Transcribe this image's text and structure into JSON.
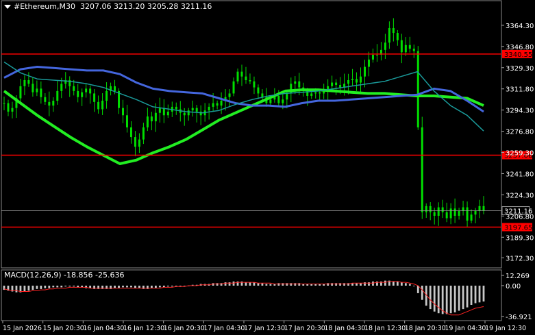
{
  "header": {
    "symbol": "#Ethereum,M30",
    "ohlc": "3207.06 3213.20 3205.28 3211.16"
  },
  "indicator": {
    "label": "MACD(12,26,9) -18.856 -25.636"
  },
  "colors": {
    "background": "#000000",
    "candles": "#00dd00",
    "ma_fast": "#22ee22",
    "ma_mid": "#4466dd",
    "ma_slow": "#1a9a9a",
    "levels": "#ff0000",
    "macd_hist": "#c8c8c8",
    "macd_signal": "#ff2222"
  },
  "chart_data": [
    {
      "type": "line",
      "title": "#Ethereum,M30",
      "ylim": [
        3164,
        3375
      ],
      "y_ticks": [
        "3364.30",
        "3346.80",
        "3329.30",
        "3311.80",
        "3294.30",
        "3276.80",
        "3259.30",
        "3241.80",
        "3224.30",
        "3206.80",
        "3189.30",
        "3172.30"
      ],
      "x_ticks": [
        "15 Jan 2026",
        "15 Jan 20:30",
        "16 Jan 04:30",
        "16 Jan 12:30",
        "16 Jan 20:30",
        "17 Jan 04:30",
        "17 Jan 12:30",
        "17 Jan 20:30",
        "18 Jan 04:30",
        "18 Jan 12:30",
        "18 Jan 20:30",
        "19 Jan 04:30",
        "19 Jan 12:30"
      ],
      "price_line": {
        "value": 3211.16,
        "label": "3211.16"
      },
      "levels": [
        {
          "value": 3340.55,
          "label": "3340.55"
        },
        {
          "value": 3257.06,
          "label": "3257.06"
        },
        {
          "value": 3197.65,
          "label": "3197.65"
        }
      ],
      "close": [
        3300,
        3293,
        3296,
        3304,
        3314,
        3319,
        3316,
        3309,
        3312,
        3305,
        3301,
        3298,
        3302,
        3310,
        3316,
        3319,
        3314,
        3310,
        3305,
        3309,
        3312,
        3308,
        3301,
        3295,
        3302,
        3310,
        3314,
        3310,
        3296,
        3290,
        3280,
        3272,
        3264,
        3270,
        3280,
        3289,
        3285,
        3292,
        3296,
        3290,
        3293,
        3297,
        3295,
        3292,
        3290,
        3294,
        3296,
        3293,
        3290,
        3294,
        3297,
        3300,
        3298,
        3302,
        3305,
        3308,
        3318,
        3326,
        3322,
        3319,
        3318,
        3313,
        3308,
        3305,
        3300,
        3303,
        3306,
        3300,
        3303,
        3308,
        3316,
        3318,
        3313,
        3310,
        3306,
        3308,
        3309,
        3308,
        3311,
        3314,
        3317,
        3315,
        3313,
        3316,
        3319,
        3320,
        3317,
        3322,
        3330,
        3336,
        3340,
        3340,
        3344,
        3350,
        3362,
        3358,
        3352,
        3342,
        3348,
        3345,
        3343,
        3280,
        3210,
        3215,
        3210,
        3207,
        3214,
        3210,
        3205,
        3213,
        3207,
        3211,
        3214,
        3203,
        3208,
        3211,
        3215,
        3211
      ],
      "series": [
        {
          "name": "",
          "values": [
            3310,
            3300,
            3290,
            3281,
            3272,
            3264,
            3257,
            3250,
            3253,
            3259,
            3264,
            3270,
            3278,
            3286,
            3292,
            3298,
            3304,
            3310,
            3311,
            3311,
            3310,
            3309,
            3308,
            3308,
            3307,
            3306,
            3306,
            3305,
            3304,
            3298
          ]
        },
        {
          "name": "",
          "values": [
            3321,
            3328,
            3330,
            3329,
            3328,
            3327,
            3327,
            3324,
            3317,
            3312,
            3310,
            3309,
            3308,
            3304,
            3300,
            3298,
            3298,
            3297,
            3300,
            3302,
            3302,
            3303,
            3304,
            3305,
            3306,
            3307,
            3312,
            3310,
            3302,
            3293
          ]
        },
        {
          "name": "",
          "values": [
            3334,
            3325,
            3320,
            3319,
            3318,
            3316,
            3313,
            3308,
            3303,
            3297,
            3295,
            3293,
            3292,
            3294,
            3299,
            3303,
            3306,
            3308,
            3309,
            3310,
            3312,
            3314,
            3316,
            3318,
            3322,
            3326,
            3310,
            3298,
            3290,
            3277
          ]
        }
      ]
    },
    {
      "type": "bar",
      "title": "MACD(12,26,9) -18.856 -25.636",
      "ylim": [
        -36.921,
        12.269
      ],
      "y_ticks": [
        "12.269",
        "0.00",
        "-36.921"
      ],
      "histogram": [
        -5,
        -6,
        -7,
        -8,
        -8,
        -7,
        -6,
        -5,
        -4,
        -4,
        -3,
        -3,
        -2,
        -2,
        -2,
        -1,
        -1,
        -1,
        -2,
        -2,
        -3,
        -3,
        -4,
        -4,
        -4,
        -4,
        -4,
        -3,
        -3,
        -2,
        -2,
        -2,
        -3,
        -3,
        -4,
        -4,
        -3,
        -3,
        -2,
        -2,
        -1,
        -1,
        -1,
        -1,
        0,
        0,
        1,
        1,
        2,
        2,
        2,
        3,
        3,
        3,
        4,
        4,
        5,
        5,
        5,
        4,
        4,
        4,
        3,
        3,
        2,
        2,
        2,
        3,
        3,
        3,
        3,
        3,
        3,
        2,
        2,
        2,
        2,
        2,
        2,
        3,
        3,
        3,
        3,
        3,
        3,
        3,
        3,
        3,
        4,
        4,
        5,
        5,
        5,
        6,
        6,
        5,
        5,
        4,
        3,
        2,
        0,
        -9,
        -17,
        -24,
        -28,
        -31,
        -33,
        -34,
        -34,
        -33,
        -32,
        -30,
        -28,
        -26,
        -23,
        -21,
        -20,
        -19
      ],
      "signal": [
        -4,
        -5,
        -6,
        -6,
        -7,
        -7,
        -7,
        -6,
        -6,
        -5,
        -5,
        -4,
        -4,
        -3,
        -3,
        -3,
        -2,
        -2,
        -2,
        -2,
        -2,
        -3,
        -3,
        -3,
        -3,
        -3,
        -3,
        -3,
        -3,
        -3,
        -3,
        -3,
        -3,
        -3,
        -3,
        -3,
        -3,
        -3,
        -3,
        -2,
        -2,
        -2,
        -1,
        -1,
        -1,
        0,
        0,
        0,
        1,
        1,
        1,
        2,
        2,
        2,
        3,
        3,
        3,
        4,
        4,
        4,
        4,
        4,
        3,
        3,
        3,
        3,
        2,
        2,
        2,
        2,
        2,
        2,
        2,
        2,
        2,
        2,
        2,
        2,
        2,
        2,
        2,
        2,
        2,
        2,
        2,
        3,
        3,
        3,
        3,
        3,
        3,
        4,
        4,
        4,
        5,
        5,
        5,
        4,
        4,
        3,
        2,
        0,
        -5,
        -11,
        -17,
        -22,
        -26,
        -30,
        -33,
        -35,
        -35,
        -35,
        -33,
        -31,
        -29,
        -27,
        -26,
        -25
      ]
    }
  ]
}
